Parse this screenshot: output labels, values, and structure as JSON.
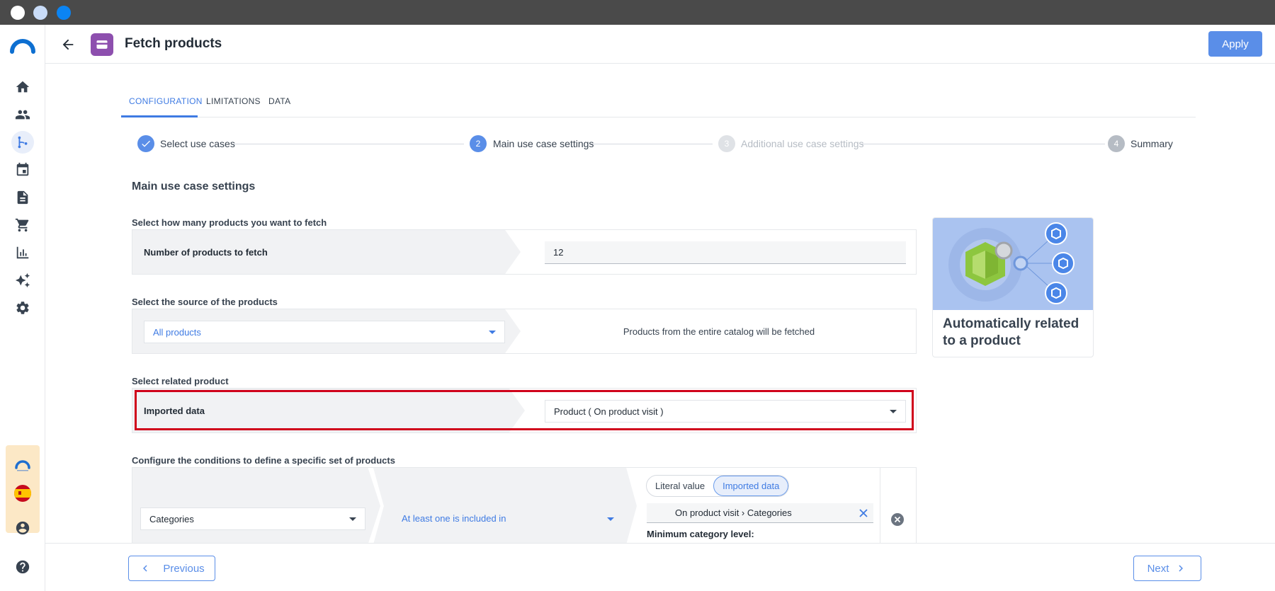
{
  "header": {
    "title": "Fetch products",
    "apply_label": "Apply"
  },
  "tabs": [
    {
      "label": "CONFIGURATION",
      "active": true
    },
    {
      "label": "LIMITATIONS",
      "active": false
    },
    {
      "label": "DATA",
      "active": false
    }
  ],
  "stepper": [
    {
      "number": "✓",
      "label": "Select use cases",
      "state": "done"
    },
    {
      "number": "2",
      "label": "Main use case settings",
      "state": "active"
    },
    {
      "number": "3",
      "label": "Additional use case settings",
      "state": "disabled"
    },
    {
      "number": "4",
      "label": "Summary",
      "state": "pending"
    }
  ],
  "section_title": "Main use case settings",
  "products_count": {
    "label": "Select how many products you want to fetch",
    "field_label": "Number of products to fetch",
    "value": "12"
  },
  "source": {
    "label": "Select the source of the products",
    "selected": "All products",
    "description": "Products from the entire catalog will be fetched"
  },
  "related": {
    "label": "Select related product",
    "field_label": "Imported data",
    "selected": "Product ( On product visit )"
  },
  "conditions": {
    "label": "Configure the conditions to define a specific set of products",
    "attribute": "Categories",
    "operator": "At least one is included in",
    "segment_literal": "Literal value",
    "segment_imported": "Imported data",
    "value_chip": "On product visit › Categories",
    "min_level_label": "Minimum category level:"
  },
  "illustration": {
    "title": "Automatically related to a product"
  },
  "footer": {
    "previous_label": "Previous",
    "next_label": "Next"
  },
  "colors": {
    "accent": "#3f7be3",
    "highlight": "#d0021b",
    "app_badge": "#8d4fae"
  }
}
